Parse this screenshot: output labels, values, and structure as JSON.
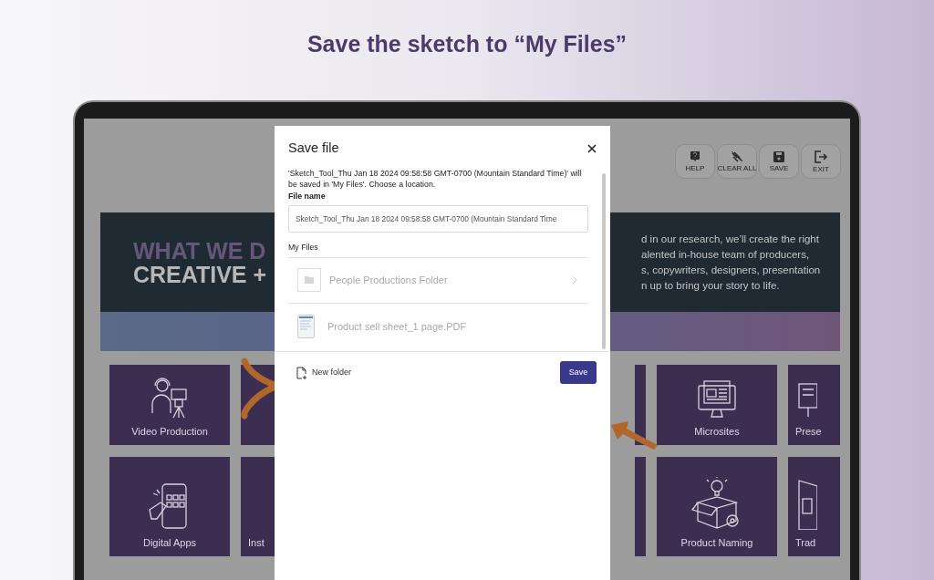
{
  "heading": "Save the sketch to “My Files”",
  "toolbar": [
    {
      "label": "HELP",
      "kind": "help"
    },
    {
      "label": "CLEAR ALL",
      "kind": "clear"
    },
    {
      "label": "SAVE",
      "kind": "save"
    },
    {
      "label": "EXIT",
      "kind": "exit"
    }
  ],
  "banner": {
    "title_line_1": "WHAT WE D",
    "title_line_2": "CREATIVE +",
    "text_lines": [
      "d in our research, we’ll create the right",
      "alented in-house team of producers,",
      "s, copywriters, designers, presentation",
      "n up to bring your story to life."
    ]
  },
  "tiles_row_1": {
    "left": [
      {
        "label": "Video Production",
        "kind": "video"
      },
      {
        "kind": "blank"
      }
    ],
    "right": [
      {
        "kind": "sliver"
      },
      {
        "label": "Microsites",
        "kind": "monitor"
      },
      {
        "label": "Prese",
        "kind": "easel"
      }
    ]
  },
  "tiles_row_2": {
    "left": [
      {
        "label": "Digital Apps",
        "kind": "phone"
      },
      {
        "label": "Inst",
        "kind": "blank"
      }
    ],
    "right": [
      {
        "kind": "sliver"
      },
      {
        "label": "Product Naming",
        "kind": "box"
      },
      {
        "label": "Trad",
        "kind": "booth"
      }
    ]
  },
  "dialog": {
    "title": "Save file",
    "message": "'Sketch_Tool_Thu Jan 18 2024 09:58:58 GMT-0700 (Mountain Standard Time)' will be saved in 'My Files'. Choose a location.",
    "file_name_label": "File name",
    "file_name_value": "Sketch_Tool_Thu Jan 18 2024 09:58:58 GMT-0700 (Mountain Standard Time",
    "location_label": "My Files",
    "items": [
      {
        "name": "People Productions Folder",
        "kind": "folder",
        "disabled": true
      },
      {
        "name": "Product sell sheet_1 page.PDF",
        "kind": "document",
        "disabled": true
      }
    ],
    "new_folder": "New folder",
    "save": "Save"
  }
}
